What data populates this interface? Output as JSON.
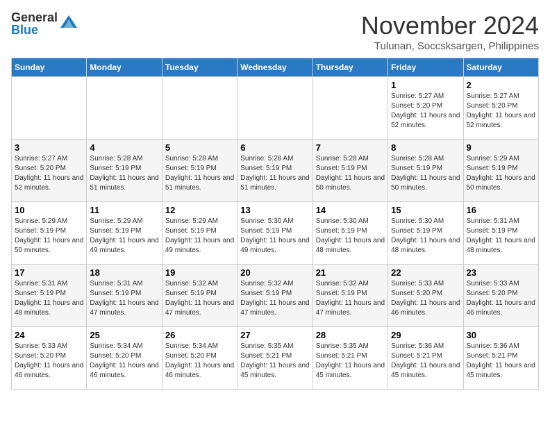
{
  "header": {
    "logo_general": "General",
    "logo_blue": "Blue",
    "month_title": "November 2024",
    "location": "Tulunan, Soccsksargen, Philippines"
  },
  "days_of_week": [
    "Sunday",
    "Monday",
    "Tuesday",
    "Wednesday",
    "Thursday",
    "Friday",
    "Saturday"
  ],
  "weeks": [
    [
      {
        "day": "",
        "info": ""
      },
      {
        "day": "",
        "info": ""
      },
      {
        "day": "",
        "info": ""
      },
      {
        "day": "",
        "info": ""
      },
      {
        "day": "",
        "info": ""
      },
      {
        "day": "1",
        "info": "Sunrise: 5:27 AM\nSunset: 5:20 PM\nDaylight: 11 hours and 52 minutes."
      },
      {
        "day": "2",
        "info": "Sunrise: 5:27 AM\nSunset: 5:20 PM\nDaylight: 11 hours and 52 minutes."
      }
    ],
    [
      {
        "day": "3",
        "info": "Sunrise: 5:27 AM\nSunset: 5:20 PM\nDaylight: 11 hours and 52 minutes."
      },
      {
        "day": "4",
        "info": "Sunrise: 5:28 AM\nSunset: 5:19 PM\nDaylight: 11 hours and 51 minutes."
      },
      {
        "day": "5",
        "info": "Sunrise: 5:28 AM\nSunset: 5:19 PM\nDaylight: 11 hours and 51 minutes."
      },
      {
        "day": "6",
        "info": "Sunrise: 5:28 AM\nSunset: 5:19 PM\nDaylight: 11 hours and 51 minutes."
      },
      {
        "day": "7",
        "info": "Sunrise: 5:28 AM\nSunset: 5:19 PM\nDaylight: 11 hours and 50 minutes."
      },
      {
        "day": "8",
        "info": "Sunrise: 5:28 AM\nSunset: 5:19 PM\nDaylight: 11 hours and 50 minutes."
      },
      {
        "day": "9",
        "info": "Sunrise: 5:29 AM\nSunset: 5:19 PM\nDaylight: 11 hours and 50 minutes."
      }
    ],
    [
      {
        "day": "10",
        "info": "Sunrise: 5:29 AM\nSunset: 5:19 PM\nDaylight: 11 hours and 50 minutes."
      },
      {
        "day": "11",
        "info": "Sunrise: 5:29 AM\nSunset: 5:19 PM\nDaylight: 11 hours and 49 minutes."
      },
      {
        "day": "12",
        "info": "Sunrise: 5:29 AM\nSunset: 5:19 PM\nDaylight: 11 hours and 49 minutes."
      },
      {
        "day": "13",
        "info": "Sunrise: 5:30 AM\nSunset: 5:19 PM\nDaylight: 11 hours and 49 minutes."
      },
      {
        "day": "14",
        "info": "Sunrise: 5:30 AM\nSunset: 5:19 PM\nDaylight: 11 hours and 48 minutes."
      },
      {
        "day": "15",
        "info": "Sunrise: 5:30 AM\nSunset: 5:19 PM\nDaylight: 11 hours and 48 minutes."
      },
      {
        "day": "16",
        "info": "Sunrise: 5:31 AM\nSunset: 5:19 PM\nDaylight: 11 hours and 48 minutes."
      }
    ],
    [
      {
        "day": "17",
        "info": "Sunrise: 5:31 AM\nSunset: 5:19 PM\nDaylight: 11 hours and 48 minutes."
      },
      {
        "day": "18",
        "info": "Sunrise: 5:31 AM\nSunset: 5:19 PM\nDaylight: 11 hours and 47 minutes."
      },
      {
        "day": "19",
        "info": "Sunrise: 5:32 AM\nSunset: 5:19 PM\nDaylight: 11 hours and 47 minutes."
      },
      {
        "day": "20",
        "info": "Sunrise: 5:32 AM\nSunset: 5:19 PM\nDaylight: 11 hours and 47 minutes."
      },
      {
        "day": "21",
        "info": "Sunrise: 5:32 AM\nSunset: 5:19 PM\nDaylight: 11 hours and 47 minutes."
      },
      {
        "day": "22",
        "info": "Sunrise: 5:33 AM\nSunset: 5:20 PM\nDaylight: 11 hours and 46 minutes."
      },
      {
        "day": "23",
        "info": "Sunrise: 5:33 AM\nSunset: 5:20 PM\nDaylight: 11 hours and 46 minutes."
      }
    ],
    [
      {
        "day": "24",
        "info": "Sunrise: 5:33 AM\nSunset: 5:20 PM\nDaylight: 11 hours and 46 minutes."
      },
      {
        "day": "25",
        "info": "Sunrise: 5:34 AM\nSunset: 5:20 PM\nDaylight: 11 hours and 46 minutes."
      },
      {
        "day": "26",
        "info": "Sunrise: 5:34 AM\nSunset: 5:20 PM\nDaylight: 11 hours and 46 minutes."
      },
      {
        "day": "27",
        "info": "Sunrise: 5:35 AM\nSunset: 5:21 PM\nDaylight: 11 hours and 45 minutes."
      },
      {
        "day": "28",
        "info": "Sunrise: 5:35 AM\nSunset: 5:21 PM\nDaylight: 11 hours and 45 minutes."
      },
      {
        "day": "29",
        "info": "Sunrise: 5:36 AM\nSunset: 5:21 PM\nDaylight: 11 hours and 45 minutes."
      },
      {
        "day": "30",
        "info": "Sunrise: 5:36 AM\nSunset: 5:21 PM\nDaylight: 11 hours and 45 minutes."
      }
    ]
  ]
}
